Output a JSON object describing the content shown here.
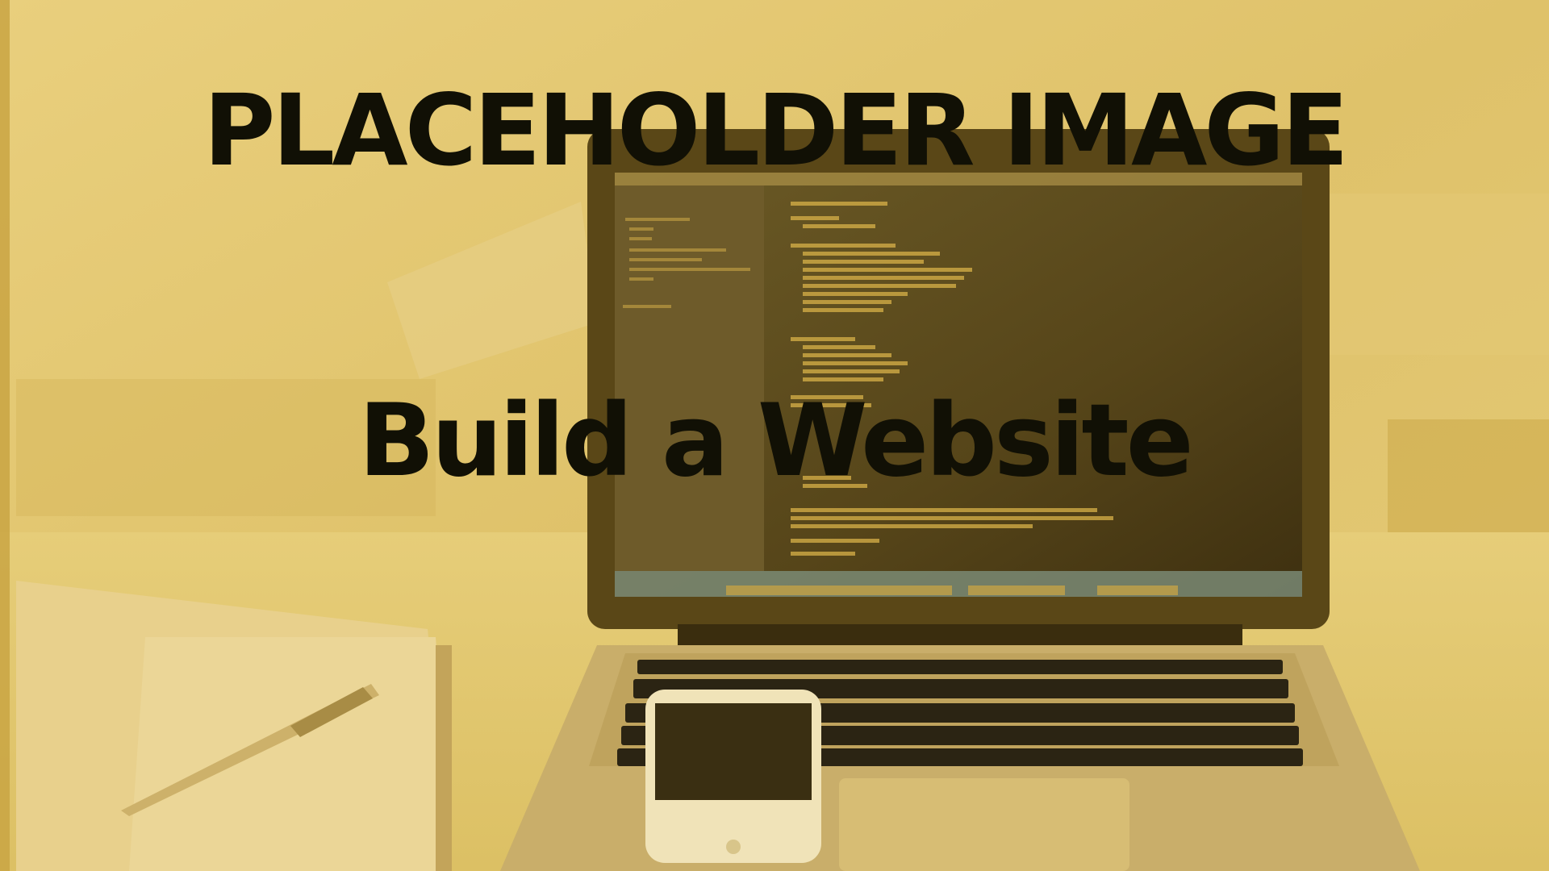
{
  "headline": "PLACEHOLDER IMAGE",
  "subline": "Build a Website",
  "colors": {
    "tint": "#dcbf5f",
    "text": "#111005",
    "screen_dark": "#4d3c17",
    "keyboard_keys": "#2b2413"
  },
  "scene": {
    "description_icons": [
      "laptop-icon",
      "phone-icon",
      "notebook-icon",
      "pen-icon"
    ]
  }
}
